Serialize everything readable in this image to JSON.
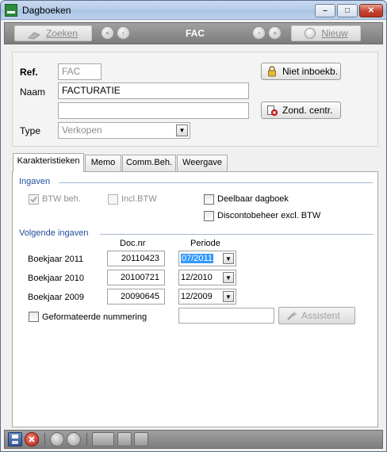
{
  "window": {
    "title": "Dagboeken"
  },
  "navbar": {
    "search_label": "Zoeken",
    "record_title": "FAC",
    "new_label": "Nieuw"
  },
  "form": {
    "ref_label": "Ref.",
    "ref_value": "FAC",
    "naam_label": "Naam",
    "naam_value": "FACTURATIE",
    "naam2_value": "",
    "type_label": "Type",
    "type_value": "Verkopen",
    "niet_inboekb_label": "Niet inboekb.",
    "zond_centr_label": "Zond. centr."
  },
  "tabs": [
    {
      "label": "Karakteristieken",
      "active": true
    },
    {
      "label": "Memo",
      "active": false
    },
    {
      "label": "Comm.Beh.",
      "active": false
    },
    {
      "label": "Weergave",
      "active": false
    }
  ],
  "ingaven": {
    "title": "Ingaven",
    "btw_beh": {
      "label": "BTW beh.",
      "checked": true,
      "enabled": false
    },
    "incl_btw": {
      "label": "Incl.BTW",
      "checked": false,
      "enabled": false
    },
    "deelbaar": {
      "label": "Deelbaar dagboek",
      "checked": false
    },
    "discontobeheer": {
      "label": "Discontobeheer excl. BTW",
      "checked": false
    }
  },
  "volgende": {
    "title": "Volgende ingaven",
    "col_docnr": "Doc.nr",
    "col_periode": "Periode",
    "rows": [
      {
        "label": "Boekjaar 2011",
        "docnr": "20110423",
        "periode": "07/2011",
        "selected": true
      },
      {
        "label": "Boekjaar 2010",
        "docnr": "20100721",
        "periode": "12/2010",
        "selected": false
      },
      {
        "label": "Boekjaar 2009",
        "docnr": "20090645",
        "periode": "12/2009",
        "selected": false
      }
    ],
    "geformateerd": {
      "label": "Geformateerde nummering",
      "checked": false
    },
    "geformateerd_value": "",
    "assistent_label": "Assistent"
  },
  "colors": {
    "section_title": "#1f4d9b",
    "selection": "#3399ff",
    "navbar": "#8c8c8c"
  }
}
